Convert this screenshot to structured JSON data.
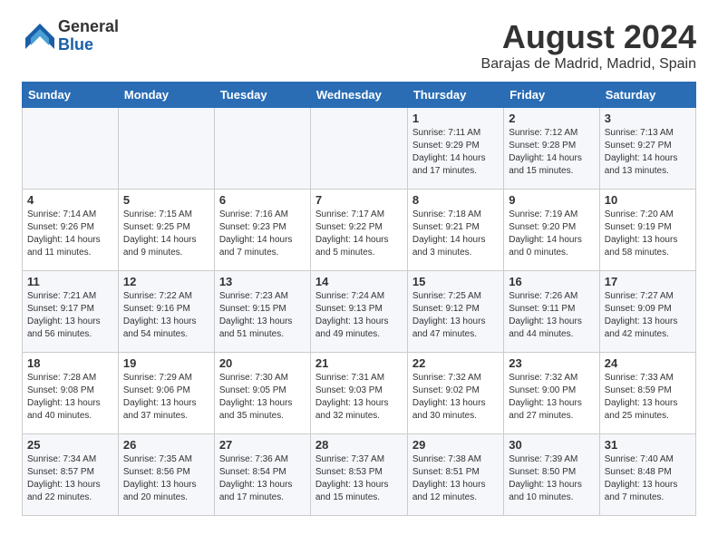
{
  "header": {
    "logo_general": "General",
    "logo_blue": "Blue",
    "title": "August 2024",
    "subtitle": "Barajas de Madrid, Madrid, Spain"
  },
  "calendar": {
    "weekdays": [
      "Sunday",
      "Monday",
      "Tuesday",
      "Wednesday",
      "Thursday",
      "Friday",
      "Saturday"
    ],
    "weeks": [
      [
        {
          "day": "",
          "info": ""
        },
        {
          "day": "",
          "info": ""
        },
        {
          "day": "",
          "info": ""
        },
        {
          "day": "",
          "info": ""
        },
        {
          "day": "1",
          "info": "Sunrise: 7:11 AM\nSunset: 9:29 PM\nDaylight: 14 hours\nand 17 minutes."
        },
        {
          "day": "2",
          "info": "Sunrise: 7:12 AM\nSunset: 9:28 PM\nDaylight: 14 hours\nand 15 minutes."
        },
        {
          "day": "3",
          "info": "Sunrise: 7:13 AM\nSunset: 9:27 PM\nDaylight: 14 hours\nand 13 minutes."
        }
      ],
      [
        {
          "day": "4",
          "info": "Sunrise: 7:14 AM\nSunset: 9:26 PM\nDaylight: 14 hours\nand 11 minutes."
        },
        {
          "day": "5",
          "info": "Sunrise: 7:15 AM\nSunset: 9:25 PM\nDaylight: 14 hours\nand 9 minutes."
        },
        {
          "day": "6",
          "info": "Sunrise: 7:16 AM\nSunset: 9:23 PM\nDaylight: 14 hours\nand 7 minutes."
        },
        {
          "day": "7",
          "info": "Sunrise: 7:17 AM\nSunset: 9:22 PM\nDaylight: 14 hours\nand 5 minutes."
        },
        {
          "day": "8",
          "info": "Sunrise: 7:18 AM\nSunset: 9:21 PM\nDaylight: 14 hours\nand 3 minutes."
        },
        {
          "day": "9",
          "info": "Sunrise: 7:19 AM\nSunset: 9:20 PM\nDaylight: 14 hours\nand 0 minutes."
        },
        {
          "day": "10",
          "info": "Sunrise: 7:20 AM\nSunset: 9:19 PM\nDaylight: 13 hours\nand 58 minutes."
        }
      ],
      [
        {
          "day": "11",
          "info": "Sunrise: 7:21 AM\nSunset: 9:17 PM\nDaylight: 13 hours\nand 56 minutes."
        },
        {
          "day": "12",
          "info": "Sunrise: 7:22 AM\nSunset: 9:16 PM\nDaylight: 13 hours\nand 54 minutes."
        },
        {
          "day": "13",
          "info": "Sunrise: 7:23 AM\nSunset: 9:15 PM\nDaylight: 13 hours\nand 51 minutes."
        },
        {
          "day": "14",
          "info": "Sunrise: 7:24 AM\nSunset: 9:13 PM\nDaylight: 13 hours\nand 49 minutes."
        },
        {
          "day": "15",
          "info": "Sunrise: 7:25 AM\nSunset: 9:12 PM\nDaylight: 13 hours\nand 47 minutes."
        },
        {
          "day": "16",
          "info": "Sunrise: 7:26 AM\nSunset: 9:11 PM\nDaylight: 13 hours\nand 44 minutes."
        },
        {
          "day": "17",
          "info": "Sunrise: 7:27 AM\nSunset: 9:09 PM\nDaylight: 13 hours\nand 42 minutes."
        }
      ],
      [
        {
          "day": "18",
          "info": "Sunrise: 7:28 AM\nSunset: 9:08 PM\nDaylight: 13 hours\nand 40 minutes."
        },
        {
          "day": "19",
          "info": "Sunrise: 7:29 AM\nSunset: 9:06 PM\nDaylight: 13 hours\nand 37 minutes."
        },
        {
          "day": "20",
          "info": "Sunrise: 7:30 AM\nSunset: 9:05 PM\nDaylight: 13 hours\nand 35 minutes."
        },
        {
          "day": "21",
          "info": "Sunrise: 7:31 AM\nSunset: 9:03 PM\nDaylight: 13 hours\nand 32 minutes."
        },
        {
          "day": "22",
          "info": "Sunrise: 7:32 AM\nSunset: 9:02 PM\nDaylight: 13 hours\nand 30 minutes."
        },
        {
          "day": "23",
          "info": "Sunrise: 7:32 AM\nSunset: 9:00 PM\nDaylight: 13 hours\nand 27 minutes."
        },
        {
          "day": "24",
          "info": "Sunrise: 7:33 AM\nSunset: 8:59 PM\nDaylight: 13 hours\nand 25 minutes."
        }
      ],
      [
        {
          "day": "25",
          "info": "Sunrise: 7:34 AM\nSunset: 8:57 PM\nDaylight: 13 hours\nand 22 minutes."
        },
        {
          "day": "26",
          "info": "Sunrise: 7:35 AM\nSunset: 8:56 PM\nDaylight: 13 hours\nand 20 minutes."
        },
        {
          "day": "27",
          "info": "Sunrise: 7:36 AM\nSunset: 8:54 PM\nDaylight: 13 hours\nand 17 minutes."
        },
        {
          "day": "28",
          "info": "Sunrise: 7:37 AM\nSunset: 8:53 PM\nDaylight: 13 hours\nand 15 minutes."
        },
        {
          "day": "29",
          "info": "Sunrise: 7:38 AM\nSunset: 8:51 PM\nDaylight: 13 hours\nand 12 minutes."
        },
        {
          "day": "30",
          "info": "Sunrise: 7:39 AM\nSunset: 8:50 PM\nDaylight: 13 hours\nand 10 minutes."
        },
        {
          "day": "31",
          "info": "Sunrise: 7:40 AM\nSunset: 8:48 PM\nDaylight: 13 hours\nand 7 minutes."
        }
      ]
    ]
  }
}
